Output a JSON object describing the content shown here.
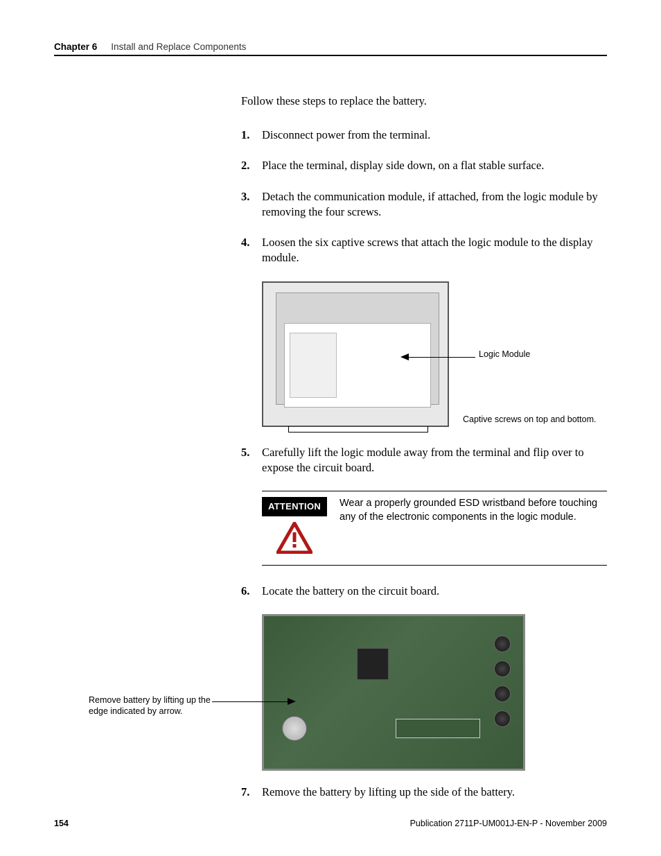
{
  "header": {
    "chapter": "Chapter 6",
    "title": "Install and Replace Components"
  },
  "intro": "Follow these steps to replace the battery.",
  "steps": {
    "s1": {
      "num": "1.",
      "text": "Disconnect power from the terminal."
    },
    "s2": {
      "num": "2.",
      "text": "Place the terminal, display side down, on a flat stable surface."
    },
    "s3": {
      "num": "3.",
      "text": "Detach the communication module, if attached, from the logic module by removing the four screws."
    },
    "s4": {
      "num": "4.",
      "text": "Loosen the six captive screws that attach the logic module to the display module."
    },
    "s5": {
      "num": "5.",
      "text": "Carefully lift the logic module away from the terminal and flip over to expose the circuit board."
    },
    "s6": {
      "num": "6.",
      "text": "Locate the battery on the circuit board."
    },
    "s7": {
      "num": "7.",
      "text": "Remove the battery by lifting up the side of the battery."
    }
  },
  "figure1": {
    "label_logic_module": "Logic Module",
    "label_captive_screws": "Captive screws on top and bottom."
  },
  "attention": {
    "badge": "ATTENTION",
    "text": "Wear a properly grounded ESD wristband before touching any of the electronic components in the logic module."
  },
  "side_note": "Remove battery by lifting up the edge indicated by arrow.",
  "footer": {
    "page": "154",
    "pub": "Publication 2711P-UM001J-EN-P - November 2009"
  }
}
